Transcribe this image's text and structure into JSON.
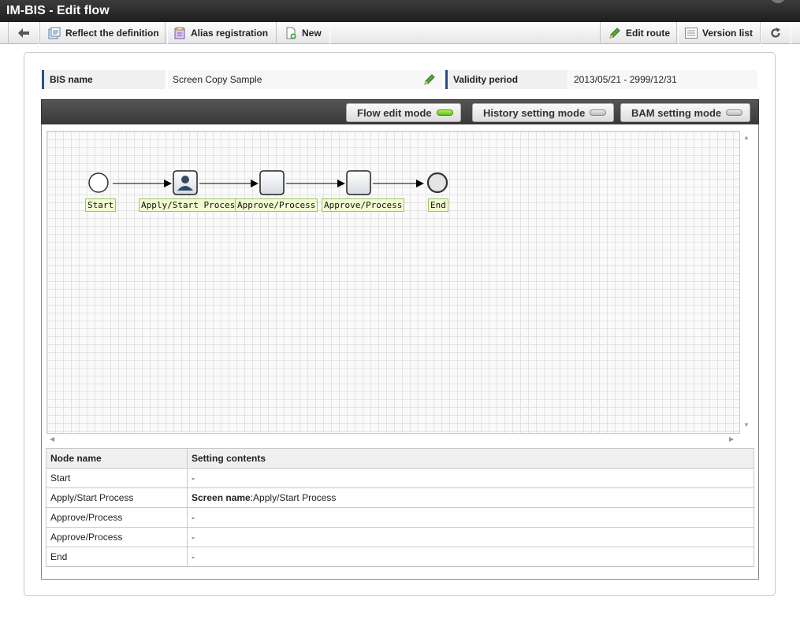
{
  "window": {
    "title": "IM-BIS - Edit flow"
  },
  "toolbar": {
    "reflect_label": "Reflect the definition",
    "alias_label": "Alias registration",
    "new_label": "New",
    "edit_route_label": "Edit route",
    "version_list_label": "Version list"
  },
  "info": {
    "bis_name_label": "BIS name",
    "bis_name_value": "Screen Copy Sample",
    "validity_label": "Validity period",
    "validity_value": "2013/05/21 - 2999/12/31"
  },
  "modes": {
    "flow_edit": "Flow edit mode",
    "history_setting": "History setting mode",
    "bam_setting": "BAM setting mode",
    "active": "flow_edit"
  },
  "flow": {
    "nodes": [
      {
        "label": "Start"
      },
      {
        "label": "Apply/Start Process"
      },
      {
        "label": "Approve/Process"
      },
      {
        "label": "Approve/Process"
      },
      {
        "label": "End"
      }
    ]
  },
  "table": {
    "headers": [
      "Node name",
      "Setting contents"
    ],
    "rows": [
      {
        "name": "Start",
        "content_key": "",
        "content": "-"
      },
      {
        "name": "Apply/Start Process",
        "content_key": "Screen name",
        "content": ":Apply/Start Process"
      },
      {
        "name": "Approve/Process",
        "content_key": "",
        "content": "-"
      },
      {
        "name": "Approve/Process",
        "content_key": "",
        "content": "-"
      },
      {
        "name": "End",
        "content_key": "",
        "content": "-"
      }
    ]
  },
  "colors": {
    "accent": "#2a4e8a",
    "lamp_on": "#5fbf1a",
    "label_bg": "#eefccf"
  }
}
